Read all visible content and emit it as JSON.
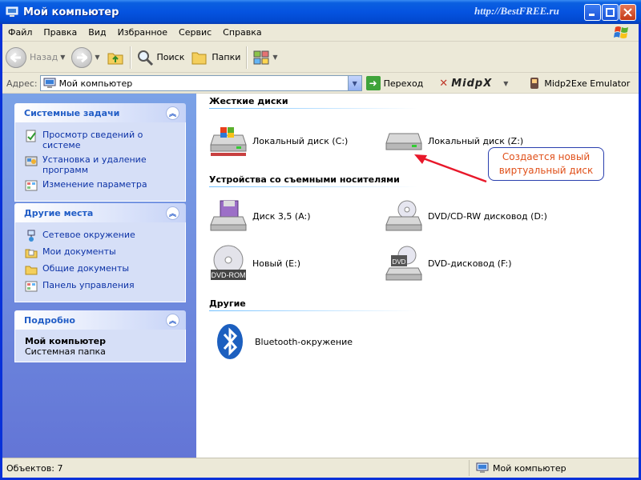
{
  "window": {
    "title": "Мой компьютер",
    "watermark": "http://BestFREE.ru"
  },
  "menu": [
    "Файл",
    "Правка",
    "Вид",
    "Избранное",
    "Сервис",
    "Справка"
  ],
  "toolbar": {
    "back_label": "Назад",
    "search_label": "Поиск",
    "folders_label": "Папки"
  },
  "address": {
    "label": "Адрес:",
    "value": "Мой компьютер",
    "go_label": "Переход",
    "plugin1_label": "MidpX",
    "plugin2_label": "Midp2Exe Emulator"
  },
  "sidebar": {
    "tasks": {
      "title": "Системные задачи",
      "items": [
        "Просмотр сведений о системе",
        "Установка и удаление программ",
        "Изменение параметра"
      ]
    },
    "places": {
      "title": "Другие места",
      "items": [
        "Сетевое окружение",
        "Мои документы",
        "Общие документы",
        "Панель управления"
      ]
    },
    "details": {
      "title": "Подробно",
      "name": "Мой компьютер",
      "type": "Системная папка"
    }
  },
  "content": {
    "sections": {
      "hard": "Жесткие диски",
      "removable": "Устройства со съемными носителями",
      "other": "Другие"
    },
    "items": {
      "disk_c": "Локальный диск (C:)",
      "disk_z": "Локальный диск (Z:)",
      "floppy": "Диск 3,5 (A:)",
      "dvdrw": "DVD/CD-RW дисковод (D:)",
      "new_e": "Новый (E:)",
      "dvd_f": "DVD-дисковод (F:)",
      "bluetooth": "Bluetooth-окружение"
    },
    "icon_text": {
      "dvdrom": "DVD-ROM",
      "dvd": "DVD"
    },
    "callout_lines": [
      "Создается новый",
      "виртуальный диск"
    ]
  },
  "statusbar": {
    "objects": "Объектов: 7",
    "location": "Мой компьютер"
  },
  "colors": {
    "title_blue": "#0553e0",
    "sidebar_blue": "#7ba2e7",
    "callout_text": "#e0501a",
    "arrow_red": "#e8182a"
  }
}
